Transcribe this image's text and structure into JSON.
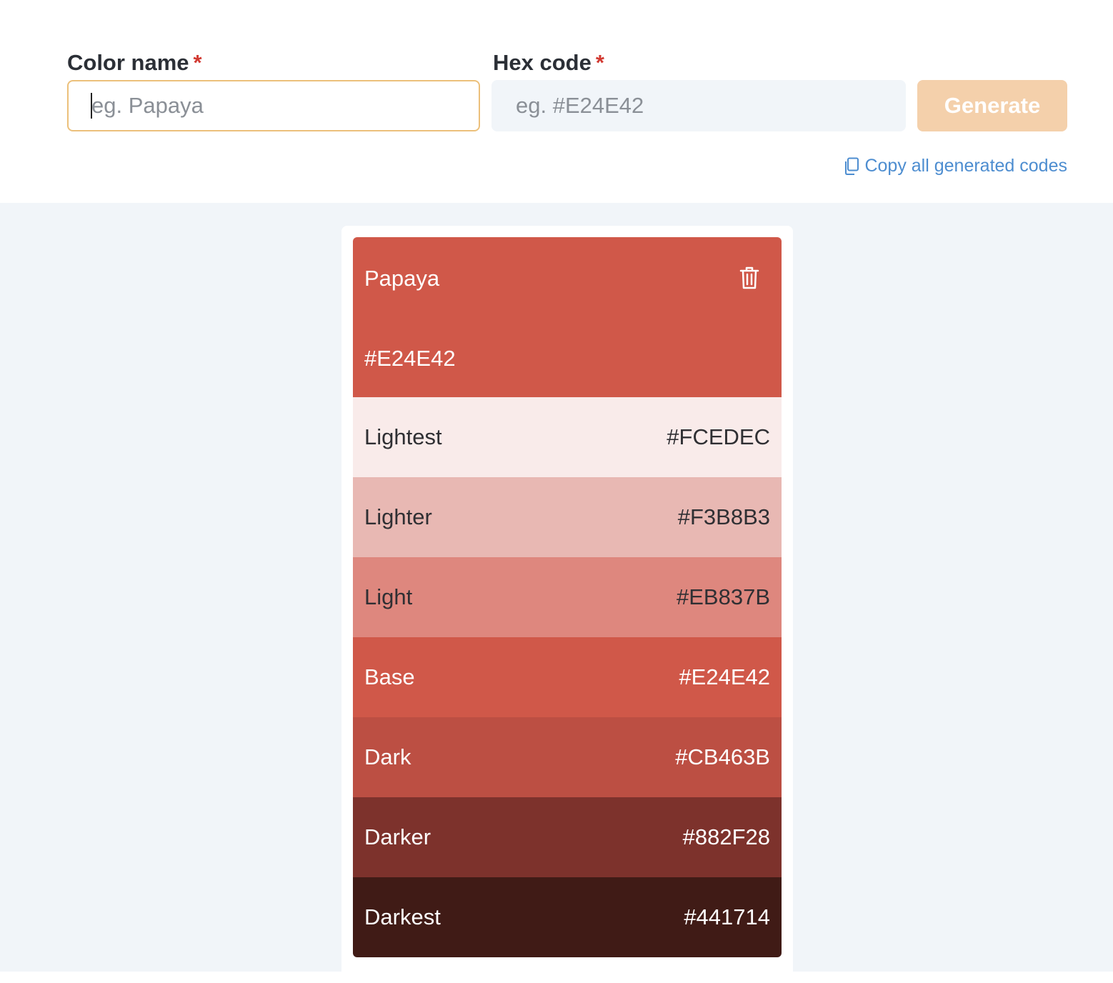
{
  "form": {
    "color_name_label": "Color name",
    "color_name_placeholder": "eg. Papaya",
    "color_name_value": "",
    "hex_code_label": "Hex code",
    "hex_code_placeholder": "eg. #E24E42",
    "hex_code_value": "",
    "required_mark": "*",
    "generate_label": "Generate",
    "copy_all_label": "Copy all generated codes"
  },
  "palette": {
    "name": "Papaya",
    "hex": "#E24E42",
    "header_color": "#d05849",
    "shades": [
      {
        "label": "Lightest",
        "hex": "#FCEDEC",
        "swatch": "#f9ebea",
        "text": "dark"
      },
      {
        "label": "Lighter",
        "hex": "#F3B8B3",
        "swatch": "#e8b8b3",
        "text": "dark"
      },
      {
        "label": "Light",
        "hex": "#EB837B",
        "swatch": "#de877e",
        "text": "dark"
      },
      {
        "label": "Base",
        "hex": "#E24E42",
        "swatch": "#d05849",
        "text": "light"
      },
      {
        "label": "Dark",
        "hex": "#CB463B",
        "swatch": "#bc4f43",
        "text": "light"
      },
      {
        "label": "Darker",
        "hex": "#882F28",
        "swatch": "#7d322c",
        "text": "light"
      },
      {
        "label": "Darkest",
        "hex": "#441714",
        "swatch": "#401b16",
        "text": "light"
      }
    ]
  },
  "icons": {
    "copy": "copy-icon",
    "delete": "trash-icon"
  }
}
